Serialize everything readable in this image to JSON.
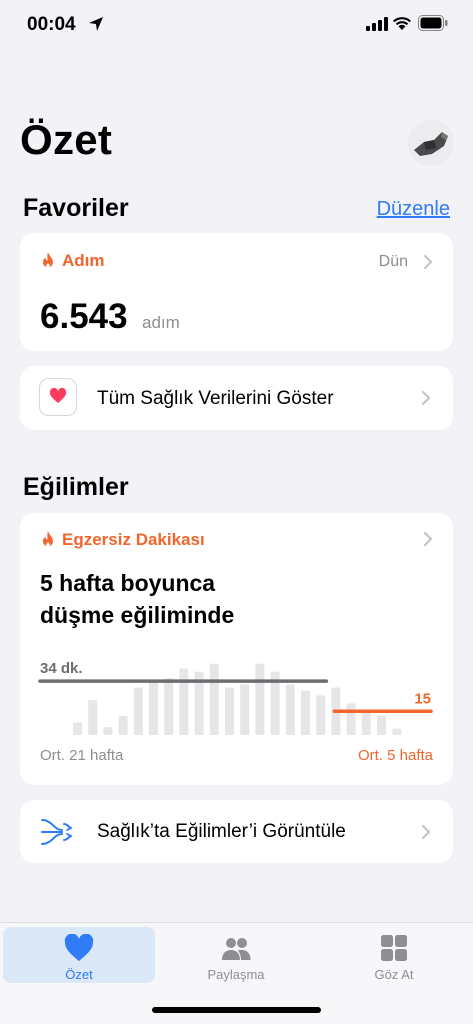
{
  "status_bar": {
    "time": "00:04"
  },
  "header": {
    "title": "Özet"
  },
  "favorites": {
    "section_title": "Favoriler",
    "edit_label": "Düzenle",
    "steps_card": {
      "label": "Adım",
      "date": "Dün",
      "value": "6.543",
      "unit": "adım"
    },
    "show_all_label": "Tüm Sağlık Verilerini Göster"
  },
  "trends": {
    "section_title": "Eğilimler",
    "card": {
      "label": "Egzersiz Dakikası",
      "headline_line1": "5 hafta boyunca",
      "headline_line2": "düşme eğiliminde",
      "avg_long_label": "34 dk.",
      "avg_short_label": "15",
      "footer_left": "Ort. 21 hafta",
      "footer_right": "Ort. 5 hafta"
    },
    "view_trends_label": "Sağlık’ta Eğilimler’i Görüntüle"
  },
  "chart_data": {
    "type": "bar",
    "title": "Egzersiz Dakikası",
    "values": [
      8,
      22,
      5,
      12,
      30,
      34,
      36,
      42,
      40,
      45,
      30,
      32,
      45,
      40,
      32,
      28,
      25,
      30,
      20,
      14,
      12,
      4
    ],
    "averages": [
      {
        "label": "34 dk.",
        "value": 34,
        "weeks": 21
      },
      {
        "label": "15",
        "value": 15,
        "weeks": 5
      }
    ],
    "ylim": [
      0,
      48
    ],
    "colors": {
      "bars": "#e6e6e8",
      "long_avg": "#6e6e72",
      "short_avg": "#f2652d"
    }
  },
  "tab_bar": {
    "tabs": [
      {
        "label": "Özet",
        "icon": "heart-icon"
      },
      {
        "label": "Paylaşma",
        "icon": "people-icon"
      },
      {
        "label": "Göz At",
        "icon": "grid-icon"
      }
    ]
  },
  "colors": {
    "accent": "#2f7cf6",
    "orange": "#f2652d",
    "background": "#f2f2f7"
  }
}
